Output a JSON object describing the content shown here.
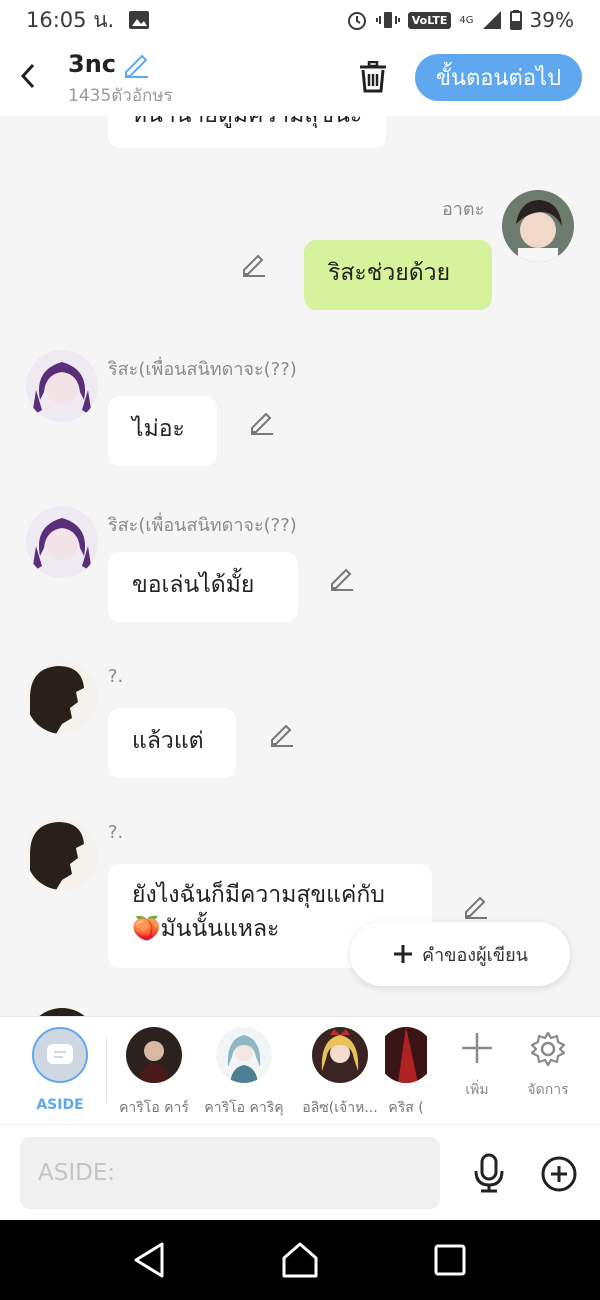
{
  "status_bar": {
    "time": "16:05 น.",
    "network": "4G",
    "volte": "VoLTE",
    "battery": "39%"
  },
  "header": {
    "title": "3nc",
    "subtitle": "1435ตัวอักษร",
    "next_label": "ขั้นตอนต่อไป"
  },
  "messages": [
    {
      "sender": "",
      "text": "หน้านายดูมีความสุขนะ"
    },
    {
      "sender": "อาตะ",
      "text": "ริสะช่วยด้วย"
    },
    {
      "sender": "ริสะ(เพื่อนสนิทดาจะ(??)",
      "text": "ไม่อะ"
    },
    {
      "sender": "ริสะ(เพื่อนสนิทดาจะ(??)",
      "text": "ขอเล่นได้มั้ย"
    },
    {
      "sender": "?.",
      "text": "แล้วแต่"
    },
    {
      "sender": "?.",
      "text": "ยังไงฉันก็มีความสุขแค่กับ🍑มันนั้นแหละ"
    }
  ],
  "writer_button": "คำของผู้เขียน",
  "characters": [
    {
      "label": "ASIDE"
    },
    {
      "label": "คาริโอ คาร์"
    },
    {
      "label": "คาริโอ คาริคุ"
    },
    {
      "label": "อลิซ(เจ้าห..."
    },
    {
      "label": "คริส ("
    }
  ],
  "actions": {
    "add": "เพิ่ม",
    "manage": "จัดการ"
  },
  "input": {
    "placeholder": "ASIDE:"
  },
  "colors": {
    "accent": "#5fa8f0",
    "my_bubble": "#d7f29c"
  }
}
